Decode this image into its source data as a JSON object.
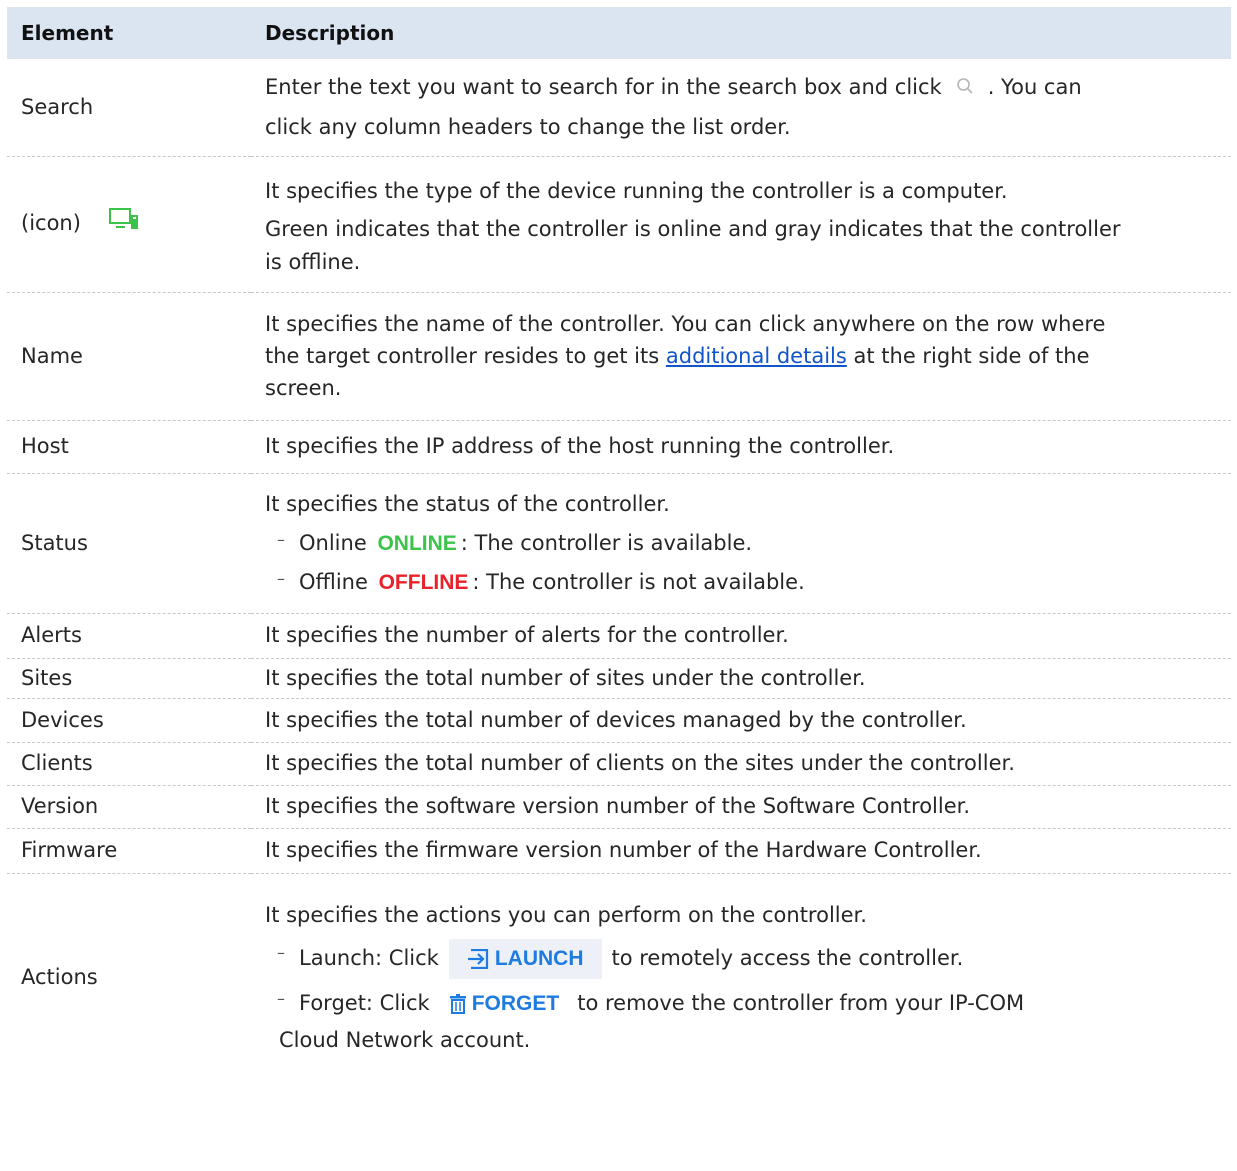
{
  "table": {
    "headers": {
      "element": "Element",
      "description": "Description"
    },
    "rows": {
      "search": {
        "element": "Search",
        "line1_a": "Enter the text you want to search for in the search box and click",
        "line1_b": ". You can",
        "line2": "click any column headers to change the list order."
      },
      "icon": {
        "element": "(icon)",
        "line1": "It specifies the type of the device running the controller is a computer.",
        "line2": "Green indicates that the controller is online and gray indicates that the controller",
        "line3": "is offline."
      },
      "name": {
        "element": "Name",
        "line1": "It specifies the name of the controller. You can click anywhere on the row where",
        "line2_a": "the target controller resides to get its",
        "line2_link": "additional details",
        "line2_b": "at the right side of the",
        "line3": "screen."
      },
      "host": {
        "element": "Host",
        "desc": "It specifies the IP address of the host running the controller."
      },
      "status": {
        "element": "Status",
        "line1": "It specifies the status of the controller.",
        "online_label": "Online",
        "online_tag": "ONLINE",
        "online_desc": ": The controller is available.",
        "offline_label": "Offline",
        "offline_tag": "OFFLINE",
        "offline_desc": ": The controller is not available."
      },
      "alerts": {
        "element": "Alerts",
        "desc": "It specifies the number of alerts for the controller."
      },
      "sites": {
        "element": "Sites",
        "desc": "It specifies the total number of sites under the controller."
      },
      "devices": {
        "element": "Devices",
        "desc": "It specifies the total number of devices managed by the controller."
      },
      "clients": {
        "element": "Clients",
        "desc": "It specifies the total number of clients on the sites under the controller."
      },
      "version": {
        "element": "Version",
        "desc": "It specifies the software version number of the Software Controller."
      },
      "firmware": {
        "element": "Firmware",
        "desc": "It specifies the firmware version number of the Hardware Controller."
      },
      "actions": {
        "element": "Actions",
        "line1": "It specifies the actions you can perform on the controller.",
        "launch_a": "Launch: Click",
        "launch_btn": "LAUNCH",
        "launch_b": "to remotely access the controller.",
        "forget_a": "Forget: Click",
        "forget_btn": "FORGET",
        "forget_b": "to remove the controller from your IP-COM",
        "forget_c": "Cloud Network account."
      }
    }
  },
  "colors": {
    "header_bg": "#dbe5f1",
    "online_green": "#3cc34a",
    "offline_red": "#e8212a",
    "button_blue": "#1e7be0",
    "link_blue": "#1155cc"
  },
  "icons": {
    "search": "search-icon",
    "computer": "computer-icon",
    "launch": "launch-icon",
    "forget": "trash-icon"
  }
}
